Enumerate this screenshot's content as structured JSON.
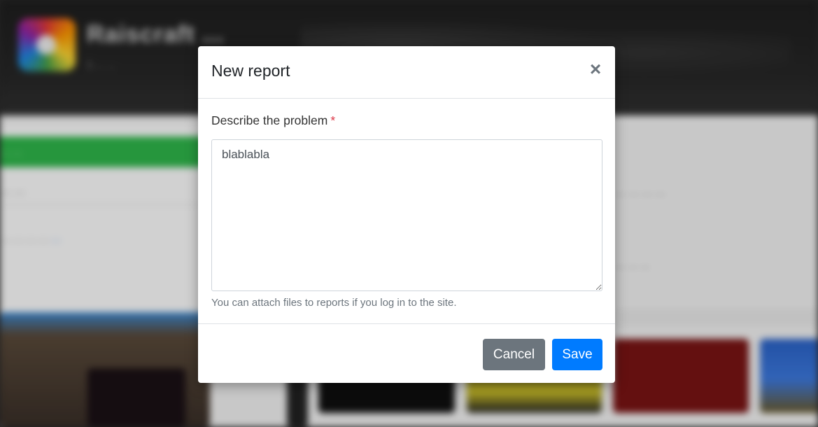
{
  "background": {
    "site_title": "Raiscraft ...",
    "meta": "1 ... ...",
    "green_bar_label": "... ...",
    "left_heading": "... ...",
    "left_text": "... ... ... ...",
    "left_link": "...",
    "right_text_1": "... ... ... ...",
    "right_text_2": "... ... ..."
  },
  "modal": {
    "title": "New report",
    "close_glyph": "×",
    "field_label": "Describe the problem",
    "required_marker": "*",
    "textarea_value": "blablabla",
    "help_text": "You can attach files to reports if you log in to the site.",
    "cancel_label": "Cancel",
    "save_label": "Save"
  },
  "colors": {
    "primary": "#007bff",
    "secondary": "#6c757d",
    "required": "#dc3545",
    "green_bar": "#2fb84b"
  }
}
